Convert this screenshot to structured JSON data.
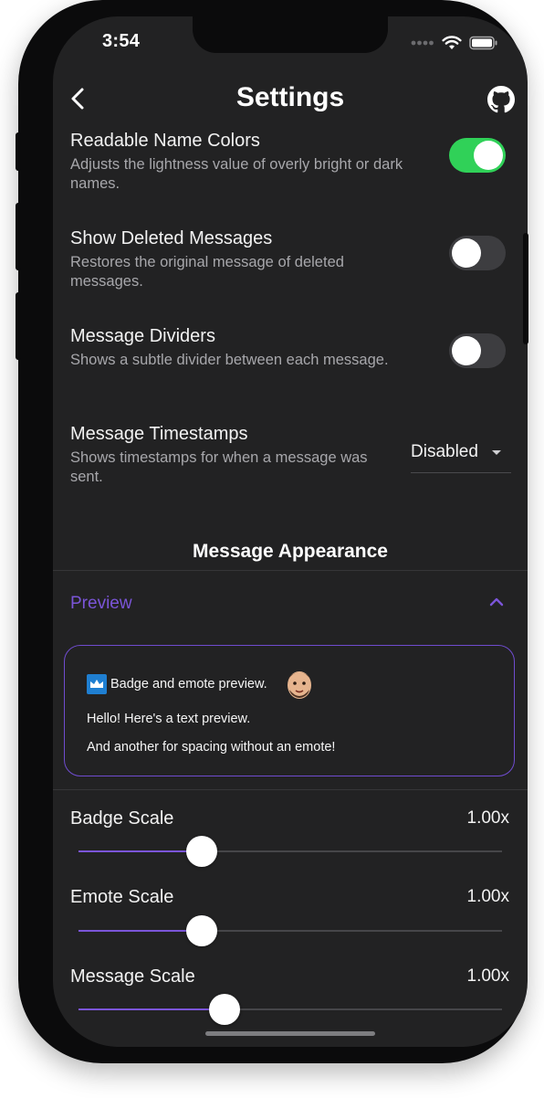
{
  "status_bar": {
    "time": "3:54"
  },
  "nav": {
    "title": "Settings"
  },
  "settings": [
    {
      "title": "Readable Name Colors",
      "description": "Adjusts the lightness value of overly bright or dark names.",
      "enabled": true
    },
    {
      "title": "Show Deleted Messages",
      "description": "Restores the original message of deleted messages.",
      "enabled": false
    },
    {
      "title": "Message Dividers",
      "description": "Shows a subtle divider between each message.",
      "enabled": false
    }
  ],
  "timestamps": {
    "title": "Message Timestamps",
    "description": "Shows timestamps for when a message was sent.",
    "selected": "Disabled"
  },
  "appearance": {
    "heading": "Message Appearance",
    "preview_label": "Preview",
    "preview": {
      "line1": "Badge and emote preview.",
      "line2": "Hello! Here's a text preview.",
      "line3": "And another for spacing without an emote!"
    }
  },
  "scales": [
    {
      "label": "Badge Scale",
      "value": "1.00x",
      "position": 0.29
    },
    {
      "label": "Emote Scale",
      "value": "1.00x",
      "position": 0.29
    },
    {
      "label": "Message Scale",
      "value": "1.00x",
      "position": 0.345
    }
  ],
  "colors": {
    "accent": "#7b55d8",
    "toggle_on": "#30d158",
    "background": "#222223"
  }
}
